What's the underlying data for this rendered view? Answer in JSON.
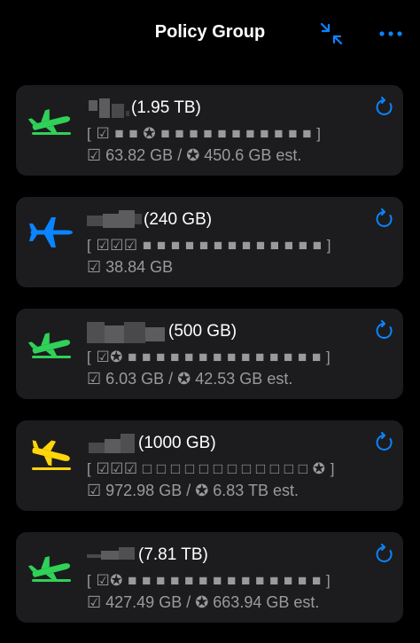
{
  "header": {
    "title": "Policy Group",
    "collapse_icon": "arrows-pointing-in-icon",
    "more_icon": "ellipsis-icon",
    "accent_color": "#0a84ff"
  },
  "colors": {
    "green": "#30d158",
    "blue": "#0a84ff",
    "yellow": "#ffd60a",
    "card": "#1c1c1e",
    "muted": "#9a9a9e"
  },
  "cards": [
    {
      "status_icon": "airplane-departure-icon",
      "status_color": "#30d158",
      "size": "(1.95 TB)",
      "progress": "[ ☑ ■ ■ ✪ ■ ■ ■ ■ ■ ■ ■ ■ ■ ■ ■ ]",
      "stats": "☑ 63.82 GB / ✪ 450.6 GB est."
    },
    {
      "status_icon": "airplane-icon",
      "status_color": "#0a84ff",
      "size": "(240 GB)",
      "progress": "[ ☑☑☑ ■ ■ ■ ■ ■ ■ ■ ■ ■ ■ ■ ■ ■ ]",
      "stats": "☑ 38.84 GB"
    },
    {
      "status_icon": "airplane-departure-icon",
      "status_color": "#30d158",
      "size": "(500 GB)",
      "progress": "[ ☑✪ ■ ■ ■ ■ ■ ■ ■ ■ ■ ■ ■ ■ ■ ■ ]",
      "stats": "☑ 6.03 GB / ✪ 42.53 GB est."
    },
    {
      "status_icon": "airplane-arrival-icon",
      "status_color": "#ffd60a",
      "size": "(1000 GB)",
      "progress": "[ ☑☑☑ □ □ □ □ □ □ □ □ □ □ □ □ ✪ ]",
      "stats": "☑ 972.98 GB / ✪ 6.83 TB est."
    },
    {
      "status_icon": "airplane-departure-icon",
      "status_color": "#30d158",
      "size": "(7.81 TB)",
      "progress": "[ ☑✪ ■ ■ ■ ■ ■ ■ ■ ■ ■ ■ ■ ■ ■ ■ ]",
      "stats": "☑ 427.49 GB / ✪ 663.94 GB est."
    }
  ]
}
